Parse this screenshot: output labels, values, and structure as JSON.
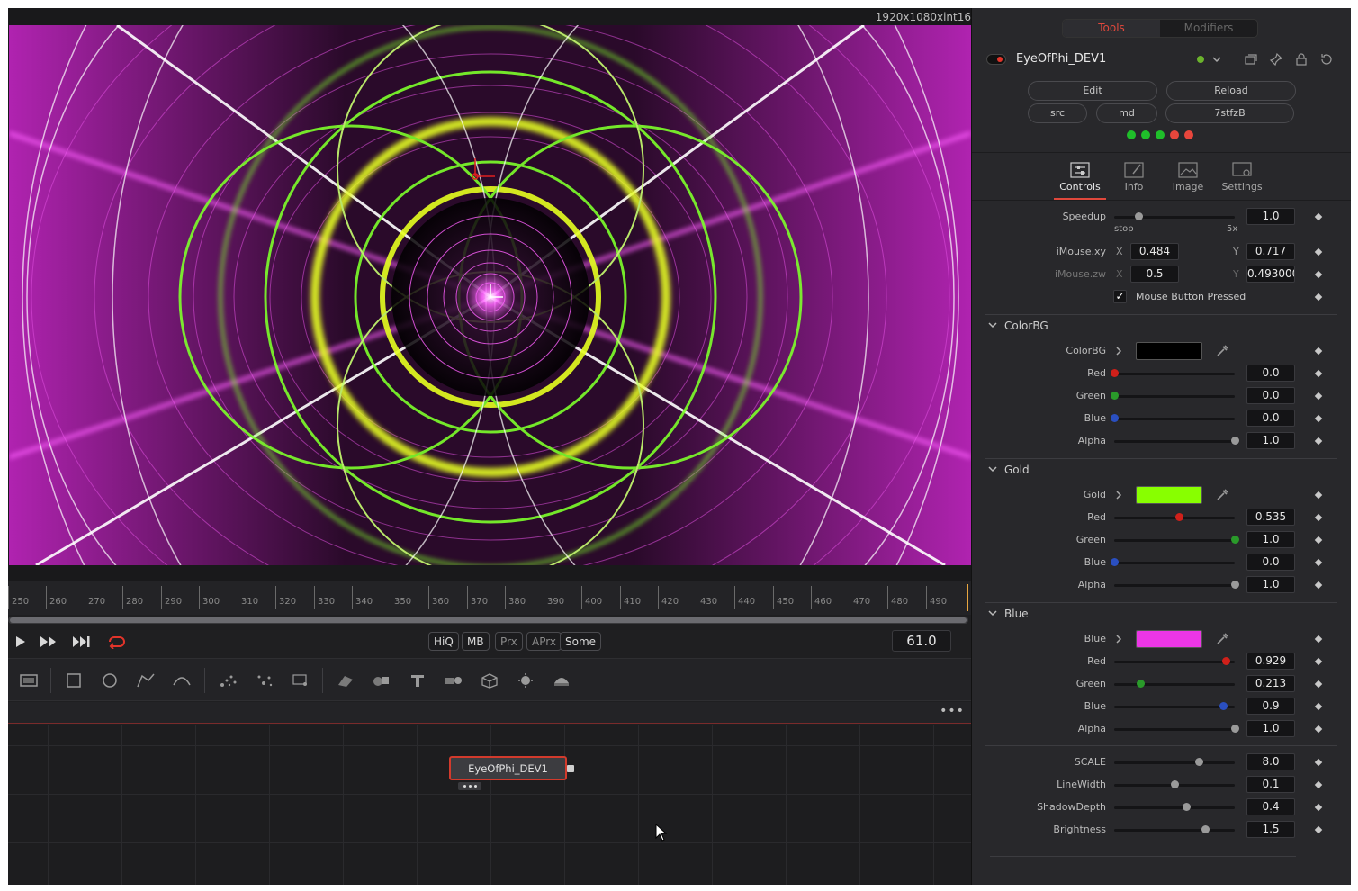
{
  "viewer": {
    "resolution_label": "1920x1080xint16"
  },
  "timeline": {
    "ticks": [
      "250",
      "260",
      "270",
      "280",
      "290",
      "300",
      "310",
      "320",
      "330",
      "340",
      "350",
      "360",
      "370",
      "380",
      "390",
      "400",
      "410",
      "420",
      "430",
      "440",
      "450",
      "460",
      "470",
      "480",
      "490"
    ]
  },
  "transport": {
    "quality_buttons": [
      {
        "label": "HiQ",
        "active": true
      },
      {
        "label": "MB",
        "active": true
      },
      {
        "label": "Prx",
        "active": false
      },
      {
        "label": "APrx",
        "active": false
      },
      {
        "label": "Some",
        "active": true
      }
    ],
    "current_frame": "61.0"
  },
  "toolbar": {
    "tools": [
      "background-icon",
      "rectangle-mask-icon",
      "ellipse-mask-icon",
      "polygon-mask-icon",
      "bspline-mask-icon",
      "particle-emitter-icon",
      "particle-render-icon",
      "particle-style-icon",
      "shape3d-icon",
      "merge3d-icon",
      "text3d-icon",
      "camera3d-icon",
      "cube3d-icon",
      "light3d-icon",
      "renderer3d-icon"
    ]
  },
  "flow": {
    "more_label": "•••",
    "node_label": "EyeOfPhi_DEV1"
  },
  "inspector": {
    "tabs": {
      "tools": "Tools",
      "modifiers": "Modifiers"
    },
    "tool_name": "EyeOfPhi_DEV1",
    "buttons": {
      "edit": "Edit",
      "reload": "Reload",
      "src": "src",
      "md": "md",
      "hash": "7stfzB"
    },
    "status_dots": [
      "#1fbf2a",
      "#1fbf2a",
      "#1fbf2a",
      "#e8463c",
      "#e8463c"
    ],
    "sub_tabs": {
      "controls": "Controls",
      "info": "Info",
      "image": "Image",
      "settings": "Settings"
    },
    "speedup": {
      "label": "Speedup",
      "value": "1.0",
      "fraction": 0.2,
      "min_label": "stop",
      "max_label": "5x"
    },
    "imouse_xy": {
      "label": "iMouse.xy",
      "x_axis": "X",
      "y_axis": "Y",
      "x": "0.484",
      "y": "0.717"
    },
    "imouse_zw": {
      "label": "iMouse.zw",
      "x_axis": "X",
      "y_axis": "Y",
      "x": "0.5",
      "y": "0.493000"
    },
    "mouse_pressed": {
      "label": "Mouse Button Pressed",
      "checked": true,
      "mark": "✓"
    },
    "color_bg": {
      "section": "ColorBG",
      "label": "ColorBG",
      "swatch": "#000000",
      "red": {
        "label": "Red",
        "value": "0.0",
        "fraction": 0.0,
        "color": "#d0201a"
      },
      "green": {
        "label": "Green",
        "value": "0.0",
        "fraction": 0.0,
        "color": "#2a9a2a"
      },
      "blue": {
        "label": "Blue",
        "value": "0.0",
        "fraction": 0.0,
        "color": "#2a4fc0"
      },
      "alpha": {
        "label": "Alpha",
        "value": "1.0",
        "fraction": 1.0,
        "color": "#9a9a9a"
      }
    },
    "gold": {
      "section": "Gold",
      "label": "Gold",
      "swatch": "#88ff00",
      "red": {
        "label": "Red",
        "value": "0.535",
        "fraction": 0.535,
        "color": "#d0201a"
      },
      "green": {
        "label": "Green",
        "value": "1.0",
        "fraction": 1.0,
        "color": "#2a9a2a"
      },
      "blue": {
        "label": "Blue",
        "value": "0.0",
        "fraction": 0.0,
        "color": "#2a4fc0"
      },
      "alpha": {
        "label": "Alpha",
        "value": "1.0",
        "fraction": 1.0,
        "color": "#9a9a9a"
      }
    },
    "blue": {
      "section": "Blue",
      "label": "Blue",
      "swatch": "#ec36e6",
      "red": {
        "label": "Red",
        "value": "0.929",
        "fraction": 0.929,
        "color": "#d0201a"
      },
      "green": {
        "label": "Green",
        "value": "0.213",
        "fraction": 0.213,
        "color": "#2a9a2a"
      },
      "blue": {
        "label": "Blue",
        "value": "0.9",
        "fraction": 0.9,
        "color": "#2a4fc0"
      },
      "alpha": {
        "label": "Alpha",
        "value": "1.0",
        "fraction": 1.0,
        "color": "#9a9a9a"
      }
    },
    "params": {
      "scale": {
        "label": "SCALE",
        "value": "8.0",
        "fraction": 0.7
      },
      "linewidth": {
        "label": "LineWidth",
        "value": "0.1",
        "fraction": 0.5
      },
      "shadowdepth": {
        "label": "ShadowDepth",
        "value": "0.4",
        "fraction": 0.6
      },
      "brightness": {
        "label": "Brightness",
        "value": "1.5",
        "fraction": 0.75
      }
    }
  }
}
